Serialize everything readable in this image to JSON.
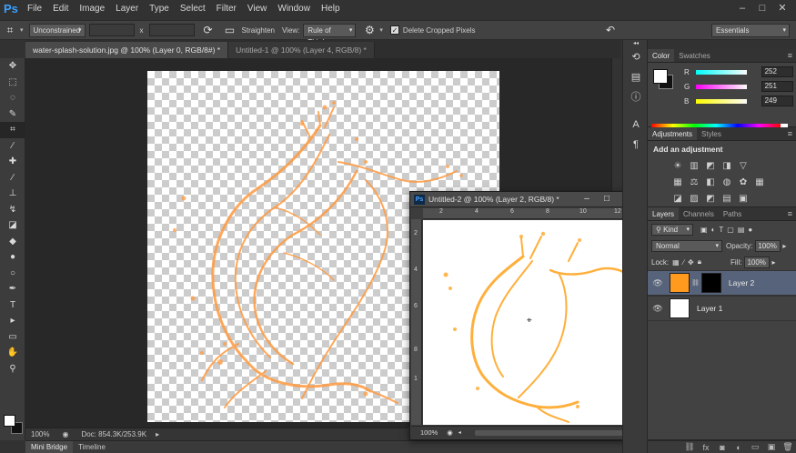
{
  "app": {
    "logo": "Ps",
    "menu": [
      "File",
      "Edit",
      "Image",
      "Layer",
      "Type",
      "Select",
      "Filter",
      "View",
      "Window",
      "Help"
    ],
    "window_controls": [
      "–",
      "□",
      "✕"
    ]
  },
  "options_bar": {
    "ratio_preset": "Unconstrained",
    "x_sep": "x",
    "straighten_label": "Straighten",
    "view_label": "View:",
    "view_value": "Rule of Thirds",
    "delete_cropped_label": "Delete Cropped Pixels",
    "delete_cropped_checked": true,
    "workspace": "Essentials"
  },
  "doc_tabs": [
    {
      "label": "water-splash-solution.jpg @ 100% (Layer 0, RGB/8#) *",
      "active": true
    },
    {
      "label": "Untitled-1 @ 100% (Layer 4, RGB/8) *",
      "active": false
    }
  ],
  "status_bar": {
    "zoom": "100%",
    "doc_size": "Doc: 854.3K/253.9K"
  },
  "bottom_tabs": [
    "Mini Bridge",
    "Timeline"
  ],
  "floating_window": {
    "title": "Untitled-2 @ 100% (Layer 2, RGB/8) *",
    "ruler_h": [
      "2",
      "4",
      "6",
      "8",
      "10",
      "12"
    ],
    "ruler_v": [
      "2",
      "4",
      "6",
      "8",
      "1"
    ],
    "zoom": "100%"
  },
  "color_panel": {
    "tabs": [
      "Color",
      "Swatches"
    ],
    "channels": [
      {
        "name": "R",
        "value": "252",
        "gradient": "#ff00ff"
      },
      {
        "name": "G",
        "value": "251",
        "gradient": "#ff00ff"
      },
      {
        "name": "B",
        "value": "249",
        "gradient": "#ffff00"
      }
    ]
  },
  "adjustments_panel": {
    "tabs": [
      "Adjustments",
      "Styles"
    ],
    "title": "Add an adjustment"
  },
  "layers_panel": {
    "tabs": [
      "Layers",
      "Channels",
      "Paths"
    ],
    "kind": "Kind",
    "blend_mode": "Normal",
    "opacity_label": "Opacity:",
    "opacity": "100%",
    "lock_label": "Lock:",
    "fill_label": "Fill:",
    "fill": "100%",
    "layers": [
      {
        "name": "Layer 2",
        "selected": true,
        "color": "#ff9a1f"
      },
      {
        "name": "Layer 1",
        "selected": false,
        "color": "#ffffff"
      }
    ]
  },
  "colors": {
    "splash": "#ff9a40",
    "ui_bg": "#323232",
    "selected_layer": "#56637a"
  }
}
